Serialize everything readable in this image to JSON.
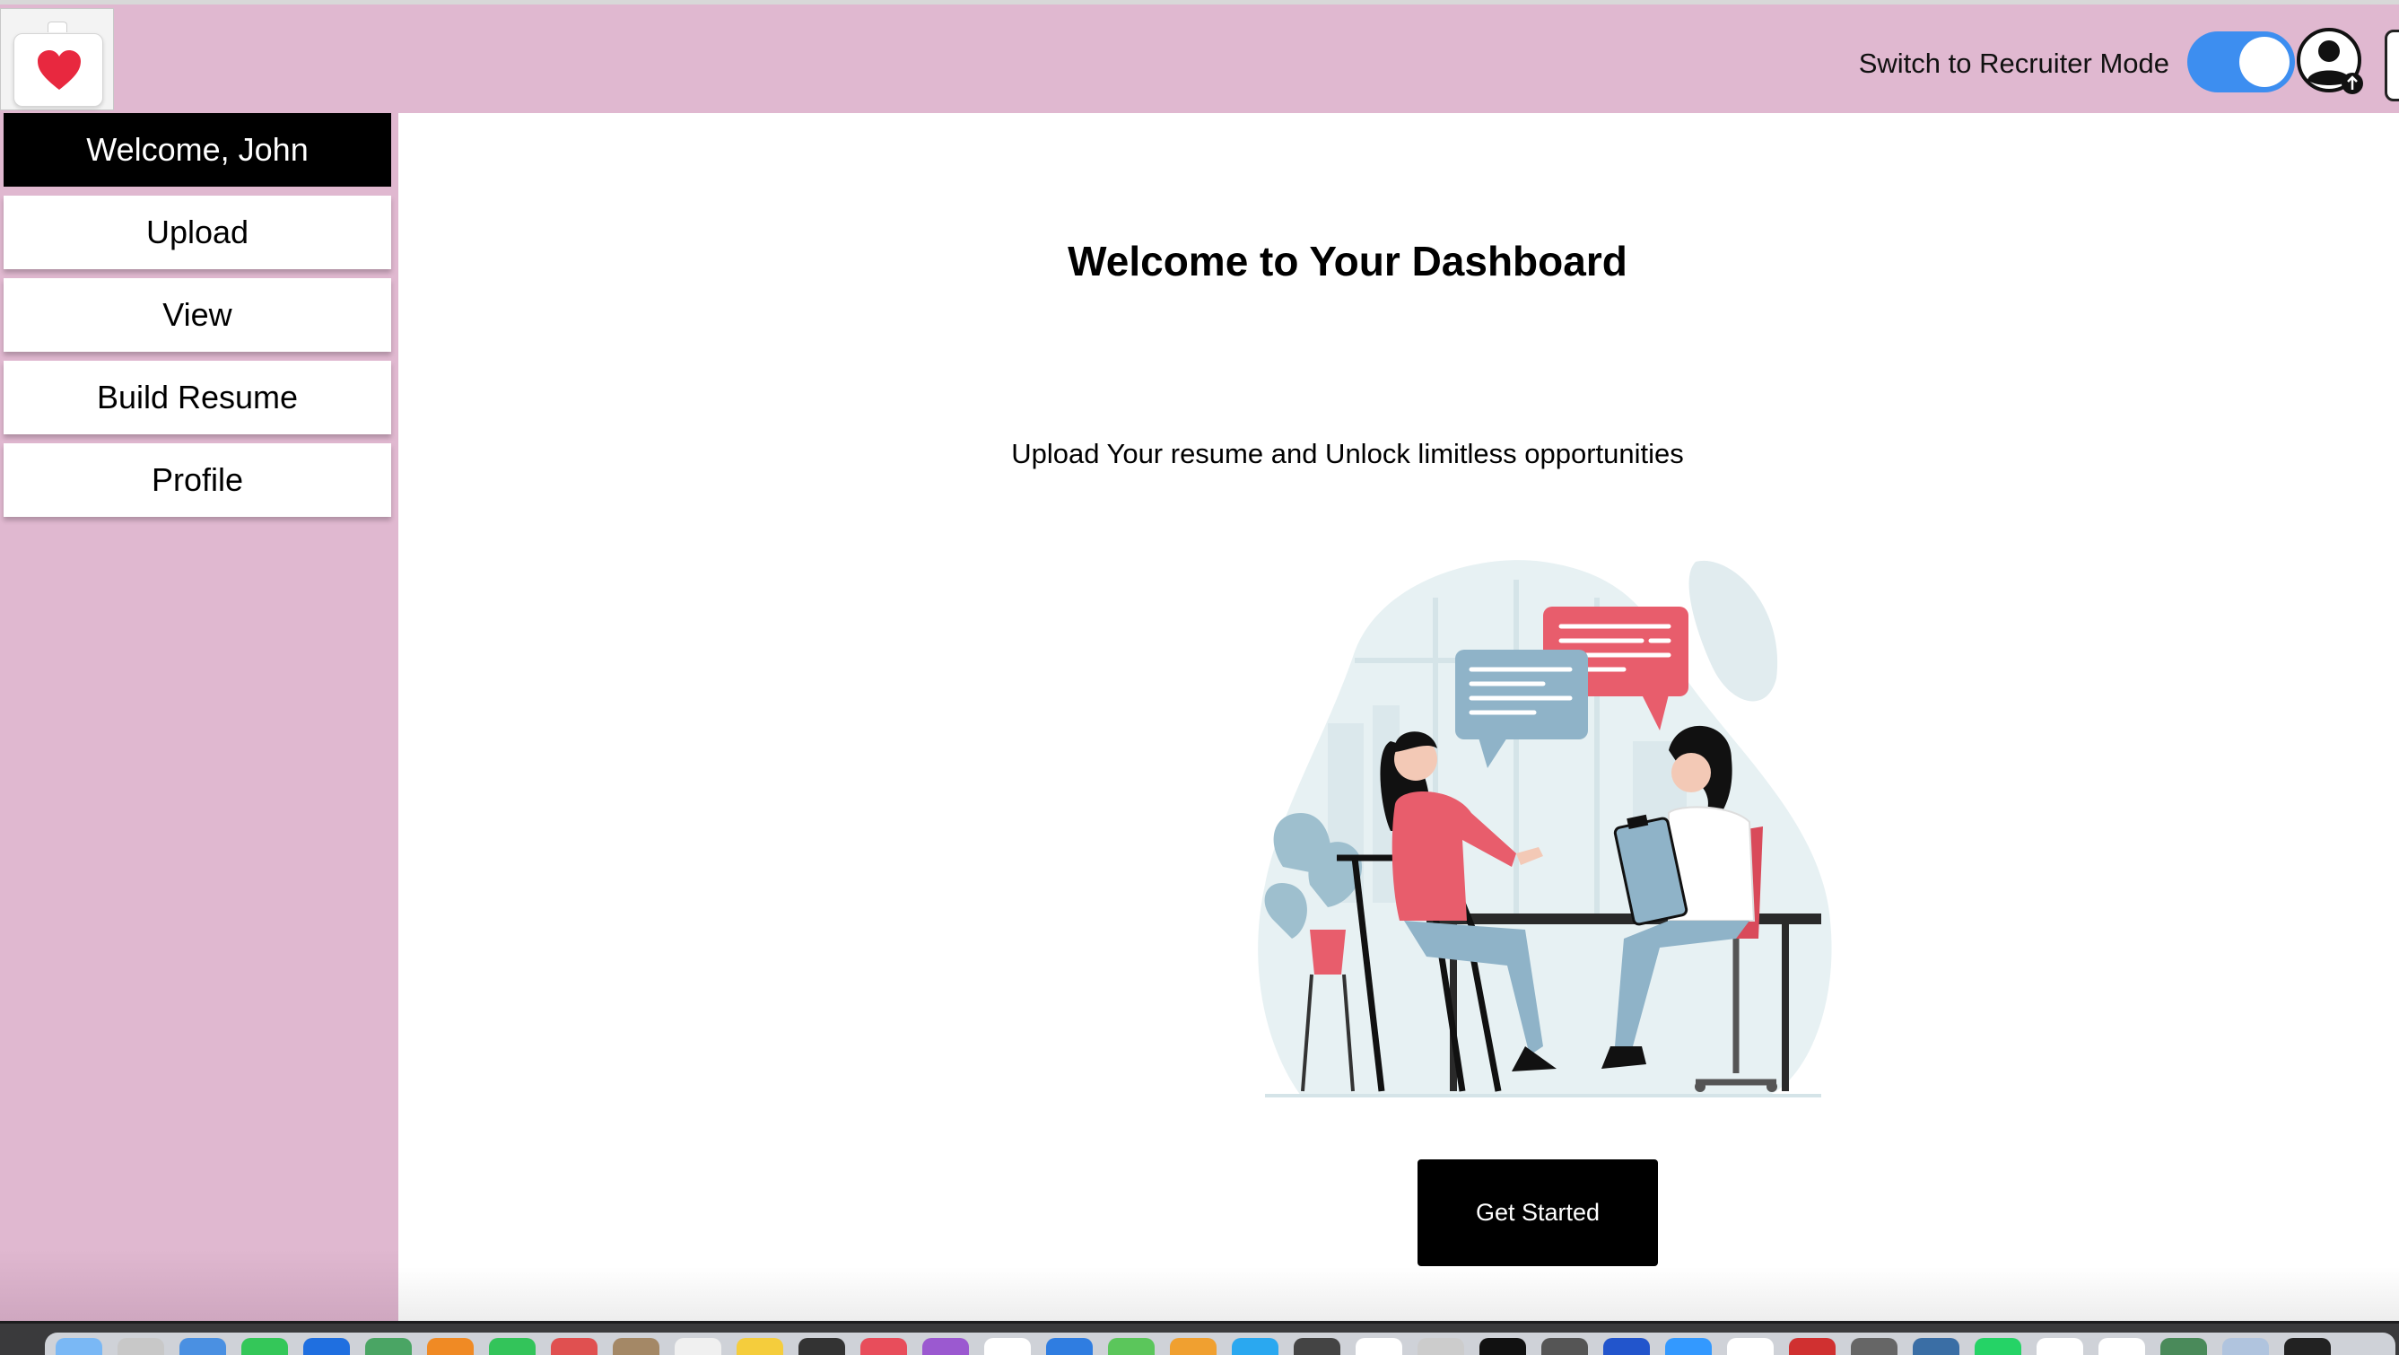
{
  "header": {
    "logo_icon": "medical-bag-heart-icon",
    "mode_toggle_label": "Switch to Recruiter Mode",
    "mode_toggle_on": true,
    "avatar_icon": "user-avatar-icon",
    "colors": {
      "bar": "#e0b8d0",
      "toggle": "#3d8ef0"
    }
  },
  "sidebar": {
    "welcome": "Welcome, John",
    "items": [
      {
        "label": "Upload"
      },
      {
        "label": "View"
      },
      {
        "label": "Build Resume"
      },
      {
        "label": "Profile"
      }
    ]
  },
  "main": {
    "title": "Welcome to Your Dashboard",
    "subtitle": "Upload Your resume and Unlock limitless opportunities",
    "illustration_icon": "interview-illustration",
    "cta_label": "Get Started"
  },
  "dock": {
    "colors": [
      "#7ab8f5",
      "#c8c8c8",
      "#4a90e2",
      "#34c759",
      "#1f6fe0",
      "#4aa564",
      "#f08a24",
      "#33c45a",
      "#e05050",
      "#a48866",
      "#f0f0f0",
      "#f5cd3c",
      "#333333",
      "#e84d5b",
      "#9b59d0",
      "#ffffff",
      "#2f7de1",
      "#5bc65b",
      "#f0a030",
      "#2aa8f0",
      "#444444",
      "#ffffff",
      "#cccccc",
      "#111111",
      "#555555",
      "#2255cc",
      "#3399ff",
      "#ffffff",
      "#d03030",
      "#666666",
      "#3a6ea5",
      "#25d366",
      "#ffffff",
      "#ffffff",
      "#4a8a5a",
      "#b0c4de",
      "#222222"
    ]
  }
}
